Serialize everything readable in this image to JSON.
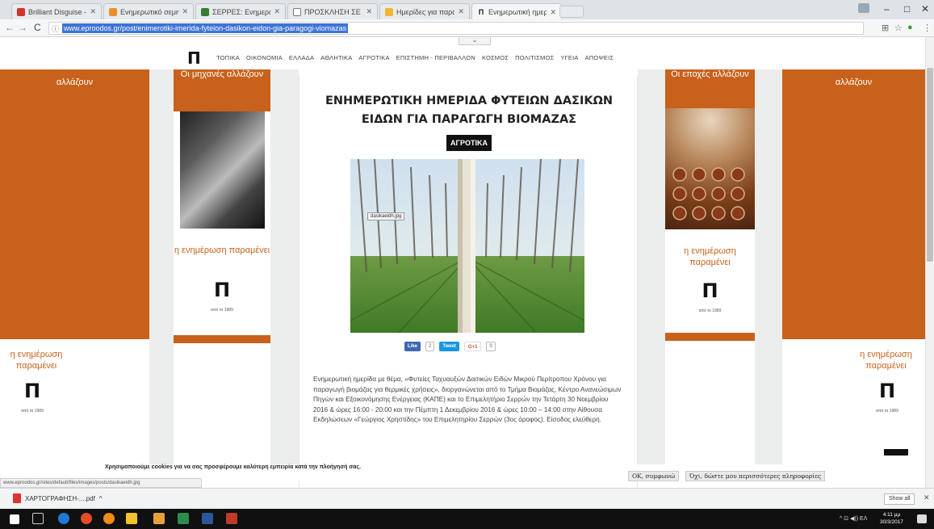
{
  "browser": {
    "tabs": [
      {
        "label": "Brilliant Disguise - Br",
        "color": "#d2352b"
      },
      {
        "label": "Ενημερωτικό σεμινάριο κατα",
        "color": "#e8912c"
      },
      {
        "label": "ΣΕΡΡΕΣ: Ενημερωτικό για",
        "color": "#3a7b34"
      },
      {
        "label": "ΠΡΟΣΚΛΗΣΗ ΣΕ ΔΗΜΟΣ",
        "color": "#777777"
      },
      {
        "label": "Ημερίδες για παραγωγή",
        "color": "#f2b531"
      },
      {
        "label": "Ενημερωτική ημερίδα φ",
        "color": "#111111"
      }
    ],
    "url": "www.eproodos.gr/post/enimerotiki-imerida-fyteion-dasikon-eidon-gia-paragogi-viomazas"
  },
  "site": {
    "logo": "Π",
    "menu": [
      "ΤΟΠΙΚΑ",
      "ΟΙΚΟΝΟΜΙΑ",
      "ΕΛΛΑΔΑ",
      "ΑΘΛΗΤΙΚΑ",
      "ΑΓΡΟΤΙΚΑ",
      "ΕΠΙΣΤΗΜΗ - ΠΕΡΙΒΑΛΛΟΝ",
      "ΚΟΣΜΟΣ",
      "ΠΟΛΙΤΙΣΜΟΣ",
      "ΥΓΕΙΑ",
      "ΑΠΟΨΕΙΣ"
    ]
  },
  "ads": {
    "far_left_top": "αλλάζουν",
    "left_top": "Οι μηχανές αλλάζουν",
    "right_top": "Οι εποχές αλλάζουν",
    "far_right_top": "αλλάζουν",
    "promo": "η ενημέρωση παραμένει",
    "logo": "Π",
    "small": "από το 1989"
  },
  "article": {
    "title": "ΕΝΗΜΕΡΩΤΙΚΗ ΗΜΕΡΙΔΑ ΦΥΤΕΙΩΝ ΔΑΣΙΚΩΝ ΕΙΔΩΝ ΓΙΑ ΠΑΡΑΓΩΓΗ ΒΙΟΜΑΖΑΣ",
    "category": "ΑΓΡΟΤΙΚΑ",
    "image_label": "dasikaeidh.jpg",
    "share": {
      "like": "Like",
      "like_count": "2",
      "tweet": "Tweet",
      "gplus": "G+1",
      "gplus_count": "0"
    },
    "body": "Ενημερωτική ημερίδα με θέμα, «Φυτείες Ταχυαυξών Δασικών Ειδών Μικρού Περίτροπου Χρόνου για παραγωγή βιομάζας για θερμικές χρήσεις», διοργανώνεται από το Τμήμα Βιομάζας, Κέντρο Ανανεώσιμων Πηγών και Εξοικονόμησης Ενέργειας (ΚΑΠΕ) και το Επιμελητήριο Σερρών την Τετάρτη 30 Νοεμβρίου 2016 & ώρες 16:00 - 20:00 και την Πέμπτη 1 Δεκεμβρίου 2016 & ώρες 10:00 – 14:00 στην Αίθουσα Εκδηλώσεων «Γεώργιος Χρηστίδης» του Επιμελητηρίου Σερρών (3ος όροφος). Είσοδος ελεύθερη."
  },
  "cookie": {
    "text": "Χρησιμοποιούμε cookies για να σας προσφέρουμε καλύτερη εμπειρία κατά την πλοήγησή σας.",
    "ok": "ΟΚ, συμφωνώ",
    "more": "Όχι, δώστε μου περισσότερες πληροφορίες"
  },
  "status_url": "www.eproodos.gr/sites/default/files/images/posts/dasikaeidh.jpg",
  "download": {
    "file": "ΧΑΡΤΟΓΡΑΦΗΣΗ-....pdf",
    "show_all": "Show all"
  },
  "taskbar": {
    "time": "4:11 μμ",
    "date": "30/3/2017",
    "lang": "ΕΛ"
  }
}
